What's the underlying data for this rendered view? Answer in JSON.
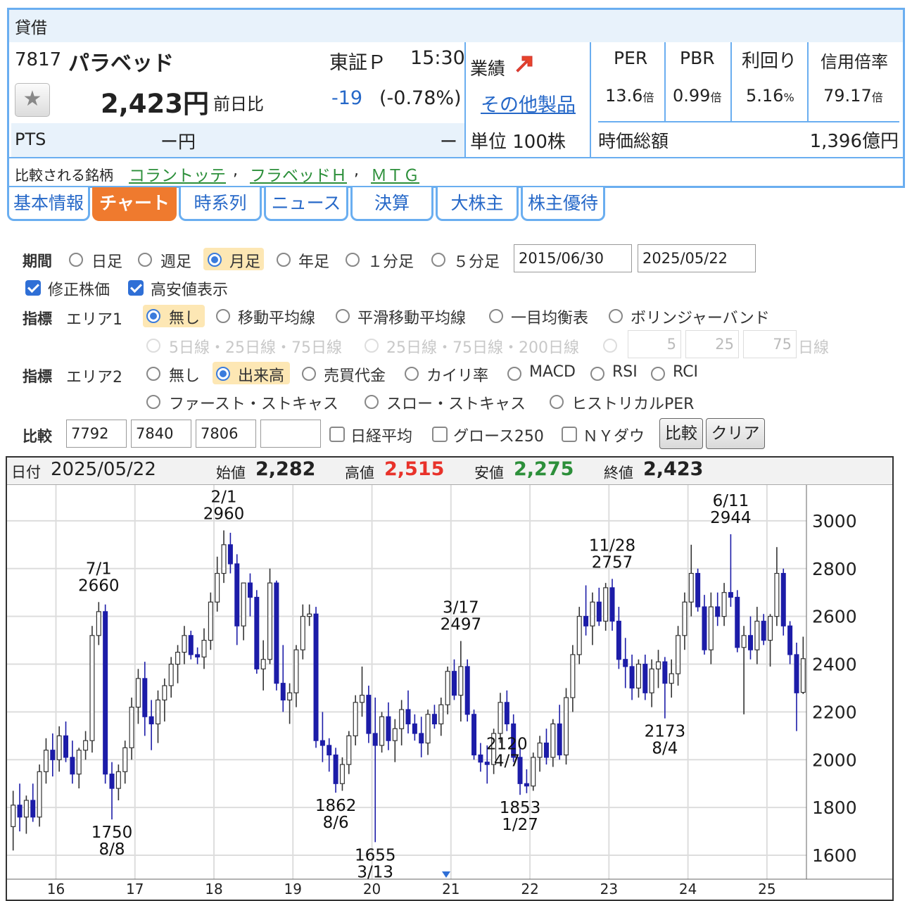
{
  "panel": {
    "title": "貸借",
    "code": "7817",
    "name": "パラベッド",
    "market": "東証Ｐ",
    "time": "15:30",
    "price": "2,423円",
    "change_label": "前日比",
    "change": "-19",
    "change_pct": "(-0.78%)",
    "pts_label": "PTS",
    "pts_price": "ー円",
    "pts_change": "ー",
    "results_label": "業績",
    "other_products": "その他製品",
    "unit": "単位 100株",
    "market_cap_label": "時価総額",
    "market_cap": "1,396億円",
    "compare_label": "比較される銘柄",
    "compare_links": [
      "コラントッテ",
      "フラベッドＨ",
      "ＭＴＧ"
    ],
    "sep": ",",
    "metrics": [
      {
        "label": "PER",
        "value": "13.6",
        "unit": "倍"
      },
      {
        "label": "PBR",
        "value": "0.99",
        "unit": "倍"
      },
      {
        "label": "利回り",
        "value": "5.16",
        "unit": "%"
      },
      {
        "label": "信用倍率",
        "value": "79.17",
        "unit": "倍"
      }
    ]
  },
  "tabs": [
    "基本情報",
    "チャート",
    "時系列",
    "ニュース",
    "決算",
    "大株主",
    "株主優待"
  ],
  "form": {
    "period_label": "期間",
    "period_options": [
      "日足",
      "週足",
      "月足",
      "年足",
      "１分足",
      "５分足"
    ],
    "period_selected": "月足",
    "date_from": "2015/06/30",
    "date_to": "2025/05/22",
    "adjusted": "修正株価",
    "high_low": "高安値表示",
    "indicator_label": "指標",
    "area1_label": "エリア1",
    "area1_options": [
      "無し",
      "移動平均線",
      "平滑移動平均線",
      "一目均衡表",
      "ボリンジャーバンド"
    ],
    "area1_disabled": [
      "5日線・25日線・75日線",
      "25日線・75日線・200日線"
    ],
    "ma_inputs": [
      "5",
      "25",
      "75"
    ],
    "ma_unit": "日線",
    "area2_label": "エリア2",
    "area2_options": [
      "無し",
      "出来高",
      "売買代金",
      "カイリ率",
      "MACD",
      "RSI",
      "RCI"
    ],
    "area2_options2": [
      "ファースト・ストキャス",
      "スロー・ストキャス",
      "ヒストリカルPER"
    ],
    "compare_label": "比較",
    "compare_codes": [
      "7792",
      "7840",
      "7806",
      ""
    ],
    "compare_checks": [
      "日経平均",
      "グロース250",
      "ＮＹダウ"
    ],
    "compare_btn": "比較",
    "clear_btn": "クリア"
  },
  "ohlc": {
    "date_label": "日付",
    "date": "2025/05/22",
    "open_label": "始値",
    "open": "2,282",
    "high_label": "高値",
    "high": "2,515",
    "low_label": "安値",
    "low": "2,275",
    "close_label": "終値",
    "close": "2,423"
  },
  "colors": {
    "up": "#ffffff",
    "down": "#1c1ca8",
    "high": "#e8322a",
    "low": "#2c8f3a",
    "accent": "#ef7a2e",
    "border": "#6aaef0"
  },
  "chart_data": {
    "type": "candlestick",
    "y_ticks": [
      1600,
      1800,
      2000,
      2200,
      2400,
      2600,
      2800,
      3000
    ],
    "x_ticks": [
      "16",
      "17",
      "18",
      "19",
      "20",
      "21",
      "22",
      "23",
      "24",
      "25"
    ],
    "grid": true,
    "annotations": [
      {
        "date": "7/1",
        "value": 2660,
        "text": "7/1",
        "val": "2660",
        "pos": "above"
      },
      {
        "date": "8/8",
        "value": 1750,
        "text": "8/8",
        "val": "1750",
        "pos": "below"
      },
      {
        "date": "2/1",
        "value": 2960,
        "text": "2/1",
        "val": "2960",
        "pos": "above"
      },
      {
        "date": "8/6",
        "value": 1862,
        "text": "8/6",
        "val": "1862",
        "pos": "below"
      },
      {
        "date": "3/13",
        "value": 1655,
        "text": "3/13",
        "val": "1655",
        "pos": "below"
      },
      {
        "date": "3/17",
        "value": 2497,
        "text": "3/17",
        "val": "2497",
        "pos": "above"
      },
      {
        "date": "1/27",
        "value": 1853,
        "text": "1/27",
        "val": "1853",
        "pos": "below"
      },
      {
        "date": "11/28",
        "value": 2757,
        "text": "11/28",
        "val": "2757",
        "pos": "above"
      },
      {
        "date": "8/4",
        "value": 2173,
        "text": "8/4",
        "val": "2173",
        "pos": "below"
      },
      {
        "date": "6/11",
        "value": 2944,
        "text": "6/11",
        "val": "2944",
        "pos": "above"
      },
      {
        "date": "4/7",
        "value": 2120,
        "text": "4/7",
        "val": "2120",
        "pos": "below"
      }
    ],
    "candles": [
      [
        1720,
        1870,
        1620,
        1810
      ],
      [
        1810,
        1900,
        1700,
        1760
      ],
      [
        1760,
        1850,
        1690,
        1830
      ],
      [
        1830,
        1900,
        1740,
        1760
      ],
      [
        1760,
        1980,
        1720,
        1950
      ],
      [
        1950,
        2090,
        1900,
        2040
      ],
      [
        2040,
        2110,
        1930,
        2000
      ],
      [
        2000,
        2140,
        1950,
        2100
      ],
      [
        2100,
        2160,
        1990,
        2010
      ],
      [
        2010,
        2080,
        1900,
        1940
      ],
      [
        1940,
        2050,
        1880,
        2040
      ],
      [
        2040,
        2120,
        2000,
        2080
      ],
      [
        2080,
        2560,
        2030,
        2520
      ],
      [
        2520,
        2660,
        2480,
        2620
      ],
      [
        2620,
        2650,
        1900,
        1940
      ],
      [
        1940,
        1990,
        1750,
        1880
      ],
      [
        1880,
        1980,
        1830,
        1950
      ],
      [
        1950,
        2080,
        1900,
        2050
      ],
      [
        2050,
        2260,
        2000,
        2220
      ],
      [
        2220,
        2380,
        2150,
        2340
      ],
      [
        2340,
        2410,
        2100,
        2180
      ],
      [
        2180,
        2250,
        2040,
        2150
      ],
      [
        2150,
        2290,
        2070,
        2250
      ],
      [
        2250,
        2340,
        2160,
        2310
      ],
      [
        2310,
        2430,
        2260,
        2400
      ],
      [
        2400,
        2480,
        2320,
        2450
      ],
      [
        2450,
        2560,
        2400,
        2520
      ],
      [
        2520,
        2540,
        2420,
        2440
      ],
      [
        2440,
        2470,
        2400,
        2430
      ],
      [
        2430,
        2550,
        2380,
        2500
      ],
      [
        2500,
        2700,
        2460,
        2660
      ],
      [
        2660,
        2850,
        2620,
        2780
      ],
      [
        2780,
        2960,
        2740,
        2900
      ],
      [
        2900,
        2950,
        2780,
        2820
      ],
      [
        2820,
        2860,
        2480,
        2560
      ],
      [
        2560,
        2720,
        2500,
        2740
      ],
      [
        2740,
        2780,
        2600,
        2680
      ],
      [
        2680,
        2710,
        2360,
        2380
      ],
      [
        2380,
        2500,
        2290,
        2420
      ],
      [
        2420,
        2800,
        2400,
        2740
      ],
      [
        2740,
        2750,
        2290,
        2320
      ],
      [
        2320,
        2480,
        2200,
        2250
      ],
      [
        2250,
        2320,
        2150,
        2280
      ],
      [
        2280,
        2480,
        2220,
        2460
      ],
      [
        2460,
        2650,
        2420,
        2600
      ],
      [
        2600,
        2650,
        2560,
        2610
      ],
      [
        2610,
        2640,
        2050,
        2080
      ],
      [
        2080,
        2200,
        1990,
        2060
      ],
      [
        2060,
        2090,
        1950,
        2020
      ],
      [
        2020,
        2050,
        1862,
        1900
      ],
      [
        1900,
        2010,
        1870,
        1980
      ],
      [
        1980,
        2120,
        1940,
        2100
      ],
      [
        2100,
        2270,
        2060,
        2240
      ],
      [
        2240,
        2390,
        2180,
        2270
      ],
      [
        2270,
        2310,
        2070,
        2110
      ],
      [
        2110,
        2260,
        1655,
        2060
      ],
      [
        2060,
        2200,
        2030,
        2180
      ],
      [
        2180,
        2240,
        2040,
        2080
      ],
      [
        2080,
        2170,
        1990,
        2130
      ],
      [
        2130,
        2250,
        2060,
        2210
      ],
      [
        2210,
        2290,
        2110,
        2150
      ],
      [
        2150,
        2190,
        2080,
        2110
      ],
      [
        2110,
        2180,
        2010,
        2070
      ],
      [
        2070,
        2210,
        2020,
        2190
      ],
      [
        2190,
        2230,
        2130,
        2150
      ],
      [
        2150,
        2260,
        2100,
        2230
      ],
      [
        2230,
        2390,
        2190,
        2370
      ],
      [
        2370,
        2420,
        2250,
        2270
      ],
      [
        2270,
        2497,
        2160,
        2390
      ],
      [
        2390,
        2420,
        2160,
        2190
      ],
      [
        2190,
        2210,
        2000,
        2020
      ],
      [
        2020,
        2070,
        1950,
        1990
      ],
      [
        1990,
        2060,
        1900,
        1980
      ],
      [
        1980,
        2130,
        1940,
        2110
      ],
      [
        2110,
        2280,
        2070,
        2240
      ],
      [
        2240,
        2290,
        2120,
        2150
      ],
      [
        2150,
        2190,
        1990,
        2010
      ],
      [
        2010,
        2050,
        1853,
        1900
      ],
      [
        1900,
        1960,
        1860,
        1890
      ],
      [
        1890,
        2030,
        1870,
        2010
      ],
      [
        2010,
        2100,
        1950,
        2070
      ],
      [
        2070,
        2130,
        1980,
        2010
      ],
      [
        2010,
        2170,
        1970,
        2150
      ],
      [
        2150,
        2230,
        2000,
        2020
      ],
      [
        2020,
        2300,
        1980,
        2260
      ],
      [
        2260,
        2480,
        2200,
        2440
      ],
      [
        2440,
        2640,
        2400,
        2600
      ],
      [
        2600,
        2730,
        2520,
        2560
      ],
      [
        2560,
        2700,
        2480,
        2660
      ],
      [
        2660,
        2720,
        2560,
        2580
      ],
      [
        2580,
        2740,
        2540,
        2720
      ],
      [
        2720,
        2757,
        2540,
        2580
      ],
      [
        2580,
        2640,
        2380,
        2420
      ],
      [
        2420,
        2510,
        2300,
        2390
      ],
      [
        2390,
        2440,
        2250,
        2300
      ],
      [
        2300,
        2420,
        2260,
        2400
      ],
      [
        2400,
        2440,
        2250,
        2280
      ],
      [
        2280,
        2420,
        2220,
        2380
      ],
      [
        2380,
        2460,
        2300,
        2410
      ],
      [
        2410,
        2430,
        2173,
        2320
      ],
      [
        2320,
        2420,
        2260,
        2360
      ],
      [
        2360,
        2560,
        2310,
        2520
      ],
      [
        2520,
        2700,
        2460,
        2660
      ],
      [
        2660,
        2900,
        2600,
        2780
      ],
      [
        2780,
        2800,
        2620,
        2640
      ],
      [
        2640,
        2690,
        2440,
        2460
      ],
      [
        2460,
        2700,
        2400,
        2640
      ],
      [
        2640,
        2700,
        2560,
        2600
      ],
      [
        2600,
        2740,
        2560,
        2700
      ],
      [
        2700,
        2944,
        2640,
        2680
      ],
      [
        2680,
        2710,
        2450,
        2470
      ],
      [
        2470,
        2560,
        2190,
        2520
      ],
      [
        2520,
        2600,
        2420,
        2460
      ],
      [
        2460,
        2640,
        2400,
        2580
      ],
      [
        2580,
        2610,
        2480,
        2500
      ],
      [
        2500,
        2610,
        2390,
        2600
      ],
      [
        2600,
        2890,
        2560,
        2780
      ],
      [
        2780,
        2800,
        2520,
        2560
      ],
      [
        2560,
        2580,
        2400,
        2440
      ],
      [
        2440,
        2490,
        2120,
        2280
      ],
      [
        2282,
        2515,
        2275,
        2423
      ]
    ],
    "x_label_at": [
      6.5,
      18.5,
      30.5,
      42.5,
      54.5,
      66.5,
      78.5,
      90.5,
      102.5,
      114.5
    ],
    "ylim": [
      1500,
      3150
    ]
  }
}
